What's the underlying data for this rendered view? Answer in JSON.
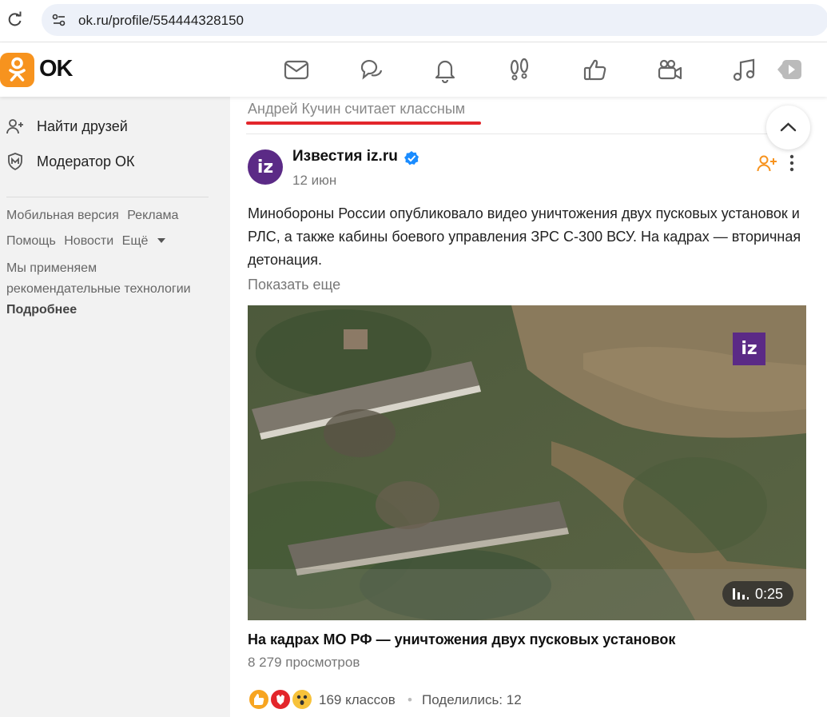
{
  "browser": {
    "url": "ok.ru/profile/554444328150"
  },
  "header": {
    "logo_text": "OK",
    "nav_icons": [
      "mail-icon",
      "chat-icon",
      "bell-icon",
      "guests-icon",
      "like-icon",
      "video-camera-icon",
      "music-icon",
      "video-play-icon"
    ]
  },
  "sidebar": {
    "items": [
      {
        "label": "Найти друзей",
        "icon": "add-friend-icon"
      },
      {
        "label": "Модератор ОК",
        "icon": "moderator-shield-icon"
      }
    ],
    "footer_links_row1": [
      "Мобильная версия",
      "Реклама"
    ],
    "footer_links_row2": [
      "Помощь",
      "Новости",
      "Ещё"
    ],
    "rec_text": "Мы применяем рекомендательные технологии",
    "rec_more": "Подробнее"
  },
  "feed": {
    "liked_by": "Андрей Кучин считает классным",
    "post": {
      "author": "Известия iz.ru",
      "avatar_text": "iz",
      "date": "12 июн",
      "text": "Минобороны России опубликовало видео уничтожения двух пусковых установок и РЛС, а также кабины боевого управления ЗРС С-300 ВСУ. На кадрах — вторичная детонация.",
      "show_more": "Показать еще",
      "video": {
        "badge": "iz",
        "duration": "0:25",
        "title": "На кадрах МО РФ — уничтожения двух пусковых установок",
        "views": "8 279 просмотров"
      },
      "likes": "169 классов",
      "separator": "•",
      "shares": "Поделились: 12"
    }
  },
  "colors": {
    "ok_orange": "#f7931e",
    "accent_red": "#e3262b",
    "iz_purple": "#5b2a86",
    "verified_blue": "#1a8cff"
  }
}
